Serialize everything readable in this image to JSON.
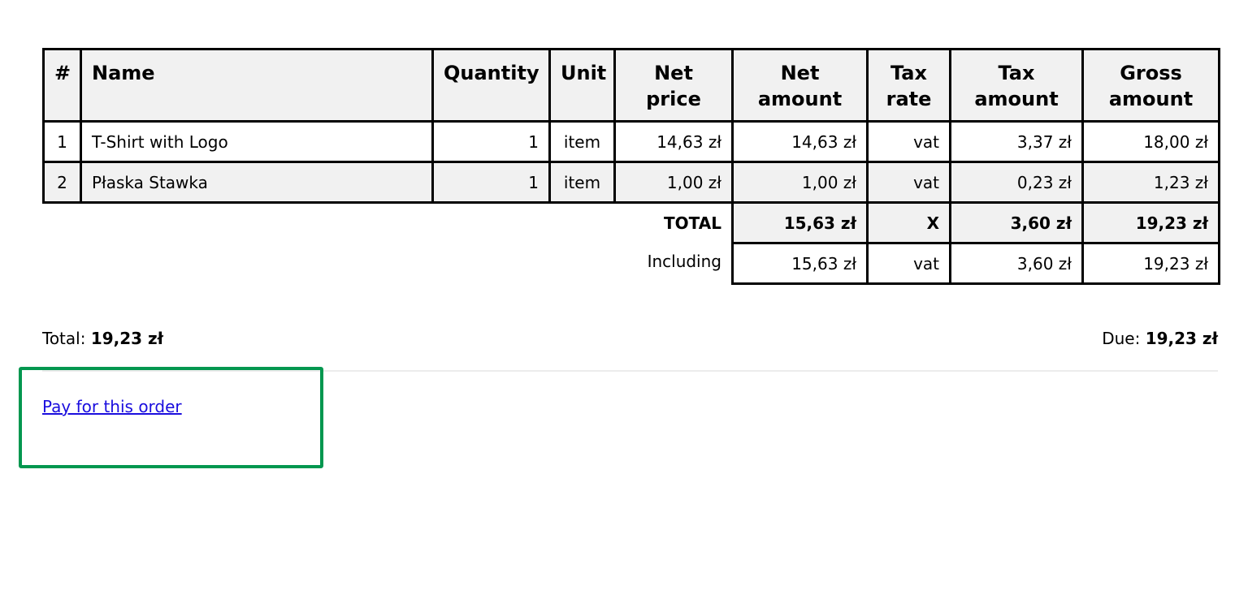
{
  "table": {
    "headers": [
      "#",
      "Name",
      "Quantity",
      "Unit",
      "Net price",
      "Net amount",
      "Tax rate",
      "Tax amount",
      "Gross amount"
    ],
    "rows": [
      [
        "1",
        "T-Shirt with Logo",
        "1",
        "item",
        "14,63 zł",
        "14,63 zł",
        "vat",
        "3,37 zł",
        "18,00 zł"
      ],
      [
        "2",
        "Płaska Stawka",
        "1",
        "item",
        "1,00 zł",
        "1,00 zł",
        "vat",
        "0,23 zł",
        "1,23 zł"
      ]
    ],
    "total": {
      "label": "TOTAL",
      "net": "15,63 zł",
      "rate": "X",
      "tax": "3,60 zł",
      "gross": "19,23 zł"
    },
    "including": {
      "label": "Including",
      "net": "15,63 zł",
      "rate": "vat",
      "tax": "3,60 zł",
      "gross": "19,23 zł"
    }
  },
  "summary": {
    "total_label": "Total:",
    "total_value": "19,23 zł",
    "due_label": "Due:",
    "due_value": "19,23 zł"
  },
  "pay_link": "Pay for this order",
  "colors": {
    "highlight_border": "#03974f",
    "link": "#1a0dde",
    "header_bg": "#f1f1f1"
  }
}
